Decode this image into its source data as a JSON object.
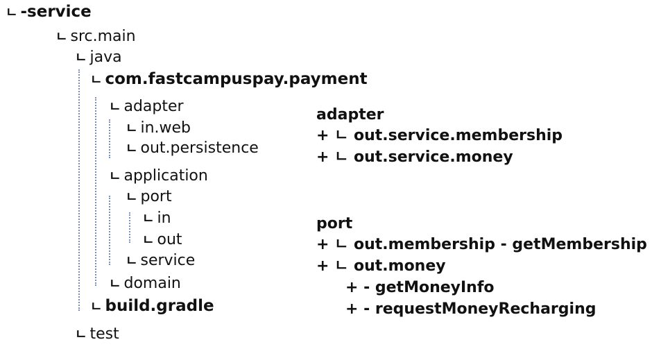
{
  "tree": {
    "root": "-service",
    "src_main": "src.main",
    "java": "java",
    "package": "com.fastcampuspay.payment",
    "adapter": "adapter",
    "in_web": "in.web",
    "out_persistence": "out.persistence",
    "application": "application",
    "port": "port",
    "in": "in",
    "out": "out",
    "service": "service",
    "domain": "domain",
    "build_gradle": "build.gradle",
    "test": "test",
    "branch_glyph": "ㄴ"
  },
  "changes": {
    "adapter_heading": "adapter",
    "adapter_items": [
      "+ ㄴ out.service.membership",
      "+ ㄴ out.service.money"
    ],
    "port_heading": "port",
    "port_items": [
      "+ ㄴ out.membership - getMembership",
      "+ ㄴ out.money"
    ],
    "money_methods": [
      "+ - getMoneyInfo",
      "+ - requestMoneyRecharging"
    ]
  },
  "colors": {
    "text": "#111111",
    "guide_line": "#7a8fc0"
  }
}
